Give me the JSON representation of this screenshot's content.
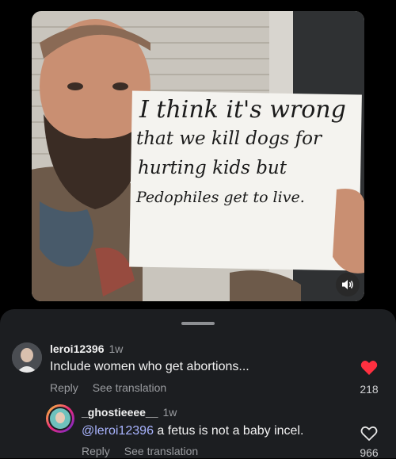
{
  "video": {
    "sign_lines": [
      "I think it's wrong",
      "that we kill dogs for",
      "hurting kids but",
      "Pedophiles get to live."
    ],
    "mute_icon": "speaker-icon"
  },
  "comments": [
    {
      "username": "leroi12396",
      "time": "1w",
      "text": "Include women who get abortions...",
      "reply_label": "Reply",
      "translate_label": "See translation",
      "likes": "218",
      "liked": true
    },
    {
      "username": "_ghostieeee__",
      "time": "1w",
      "mention": "@leroi12396",
      "text": " a fetus is not a baby incel.",
      "reply_label": "Reply",
      "translate_label": "See translation",
      "likes": "966",
      "liked": false
    }
  ],
  "colors": {
    "sheet_bg": "#1c1e21",
    "like_red": "#ff3040",
    "mention_blue": "#a9b4ff"
  }
}
